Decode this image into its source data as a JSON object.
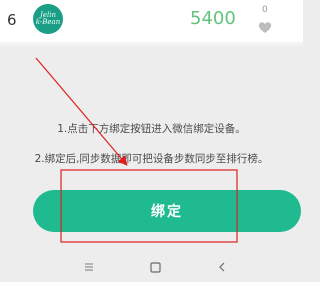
{
  "ranking_row": {
    "rank": "6",
    "avatar_text": "Jelin\nk-Bean",
    "steps": "5400",
    "likes": "0",
    "like_icon": "heart-icon"
  },
  "instructions": {
    "line1": "1.点击下方绑定按钮进入微信绑定设备。",
    "line2": "2.绑定后,同步数据即可把设备步数同步至排行榜。"
  },
  "bind_button": {
    "label": "绑定"
  },
  "navbar": {
    "menu_icon": "menu-icon",
    "home_icon": "home-square-icon",
    "back_icon": "back-chevron-icon"
  },
  "colors": {
    "accent_green": "#1fba8f",
    "steps_green": "#62c47a",
    "annotation_red": "#e02020",
    "background": "#ededed"
  }
}
